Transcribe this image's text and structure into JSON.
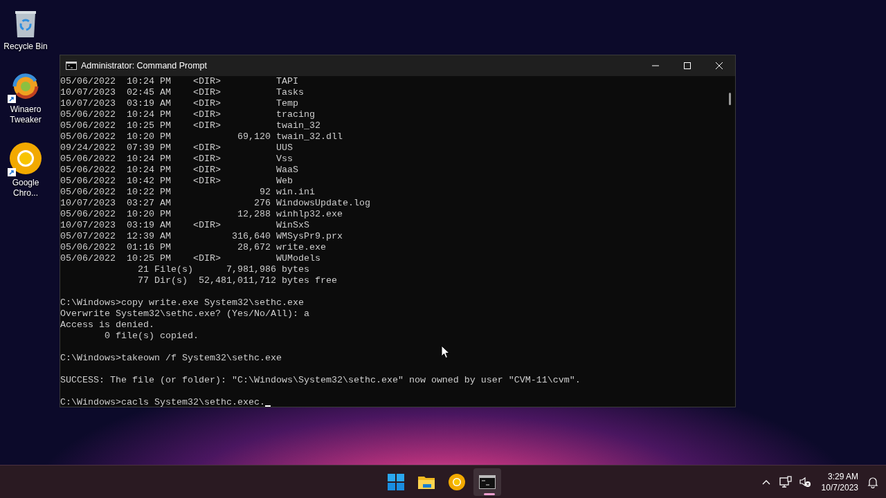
{
  "desktop_icons": [
    {
      "label": "Recycle Bin",
      "kind": "recycle",
      "shortcut": false
    },
    {
      "label": "Winaero Tweaker",
      "kind": "winaero",
      "shortcut": true
    },
    {
      "label": "Google Chro...",
      "kind": "chrome",
      "shortcut": true
    }
  ],
  "window": {
    "title": "Administrator: Command Prompt",
    "console": {
      "cursor_visible": true,
      "blocks": [
        [
          "05/06/2022  10:24 PM    <DIR>          TAPI",
          "10/07/2023  02:45 AM    <DIR>          Tasks",
          "10/07/2023  03:19 AM    <DIR>          Temp",
          "05/06/2022  10:24 PM    <DIR>          tracing",
          "05/06/2022  10:25 PM    <DIR>          twain_32",
          "05/06/2022  10:20 PM            69,120 twain_32.dll",
          "09/24/2022  07:39 PM    <DIR>          UUS",
          "05/06/2022  10:24 PM    <DIR>          Vss",
          "05/06/2022  10:24 PM    <DIR>          WaaS",
          "05/06/2022  10:42 PM    <DIR>          Web",
          "05/06/2022  10:22 PM                92 win.ini",
          "10/07/2023  03:27 AM               276 WindowsUpdate.log",
          "05/06/2022  10:20 PM            12,288 winhlp32.exe",
          "10/07/2023  03:19 AM    <DIR>          WinSxS",
          "05/07/2022  12:39 AM           316,640 WMSysPr9.prx",
          "05/06/2022  01:16 PM            28,672 write.exe",
          "05/06/2022  10:25 PM    <DIR>          WUModels",
          "              21 File(s)      7,981,986 bytes",
          "              77 Dir(s)  52,481,011,712 bytes free"
        ],
        [
          "C:\\Windows>copy write.exe System32\\sethc.exe",
          "Overwrite System32\\sethc.exe? (Yes/No/All): a",
          "Access is denied.",
          "        0 file(s) copied."
        ],
        [
          "C:\\Windows>takeown /f System32\\sethc.exe"
        ],
        [
          "SUCCESS: The file (or folder): \"C:\\Windows\\System32\\sethc.exe\" now owned by user \"CVM-11\\cvm\"."
        ],
        [
          "C:\\Windows>cacls System32\\sethc.exec."
        ]
      ]
    }
  },
  "taskbar": {
    "apps": [
      {
        "kind": "start",
        "active": false
      },
      {
        "kind": "explorer",
        "active": false
      },
      {
        "kind": "chrome",
        "active": false
      },
      {
        "kind": "terminal",
        "active": true
      }
    ],
    "time": "3:29 AM",
    "date": "10/7/2023"
  }
}
